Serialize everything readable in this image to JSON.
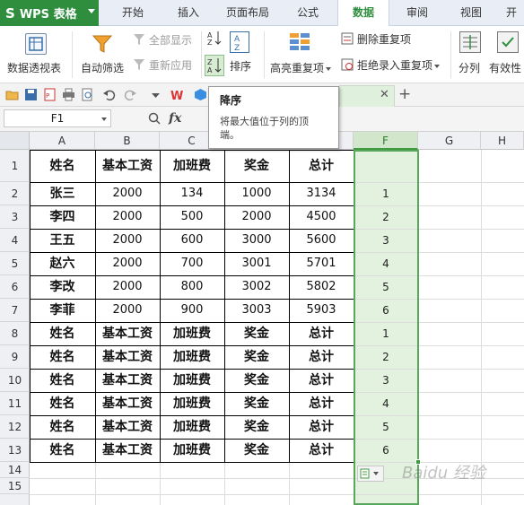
{
  "app": {
    "title": "WPS 表格",
    "logo": "S"
  },
  "tabs": [
    {
      "label": "开始"
    },
    {
      "label": "插入"
    },
    {
      "label": "页面布局"
    },
    {
      "label": "公式"
    },
    {
      "label": "数据"
    },
    {
      "label": "审阅"
    },
    {
      "label": "视图"
    },
    {
      "label": "开"
    }
  ],
  "ribbon": {
    "pivot": "数据透视表",
    "autofilter": "自动筛选",
    "show_all": "全部显示",
    "reapply": "重新应用",
    "sort": "排序",
    "highlight_dup": "高亮重复项",
    "remove_dup": "删除重复项",
    "reject_dup": "拒绝录入重复项",
    "split": "分列",
    "validity": "有效性"
  },
  "tooltip": {
    "title": "降序",
    "desc": "将最大值位于列的顶端。"
  },
  "formula_bar": {
    "name_box": "F1",
    "fx": "fx"
  },
  "columns": [
    "A",
    "B",
    "C",
    "D",
    "E",
    "F",
    "G",
    "H"
  ],
  "rows": [
    "1",
    "2",
    "3",
    "4",
    "5",
    "6",
    "7",
    "8",
    "9",
    "10",
    "11",
    "12",
    "13",
    "14",
    "15"
  ],
  "table": {
    "header": [
      "姓名",
      "基本工资",
      "加班费",
      "奖金",
      "总计"
    ],
    "data": [
      [
        "张三",
        "2000",
        "134",
        "1000",
        "3134"
      ],
      [
        "李四",
        "2000",
        "500",
        "2000",
        "4500"
      ],
      [
        "王五",
        "2000",
        "600",
        "3000",
        "5600"
      ],
      [
        "赵六",
        "2000",
        "700",
        "3001",
        "5701"
      ],
      [
        "李改",
        "2000",
        "800",
        "3002",
        "5802"
      ],
      [
        "李菲",
        "2000",
        "900",
        "3003",
        "5903"
      ],
      [
        "姓名",
        "基本工资",
        "加班费",
        "奖金",
        "总计"
      ],
      [
        "姓名",
        "基本工资",
        "加班费",
        "奖金",
        "总计"
      ],
      [
        "姓名",
        "基本工资",
        "加班费",
        "奖金",
        "总计"
      ],
      [
        "姓名",
        "基本工资",
        "加班费",
        "奖金",
        "总计"
      ],
      [
        "姓名",
        "基本工资",
        "加班费",
        "奖金",
        "总计"
      ],
      [
        "姓名",
        "基本工资",
        "加班费",
        "奖金",
        "总计"
      ]
    ],
    "col_f": [
      "",
      "1",
      "2",
      "3",
      "4",
      "5",
      "6",
      "1",
      "2",
      "3",
      "4",
      "5",
      "6"
    ]
  },
  "watermark": "Baidu 经验",
  "colors": {
    "accent": "#2e8e3e",
    "selection": "#e3f1df"
  }
}
